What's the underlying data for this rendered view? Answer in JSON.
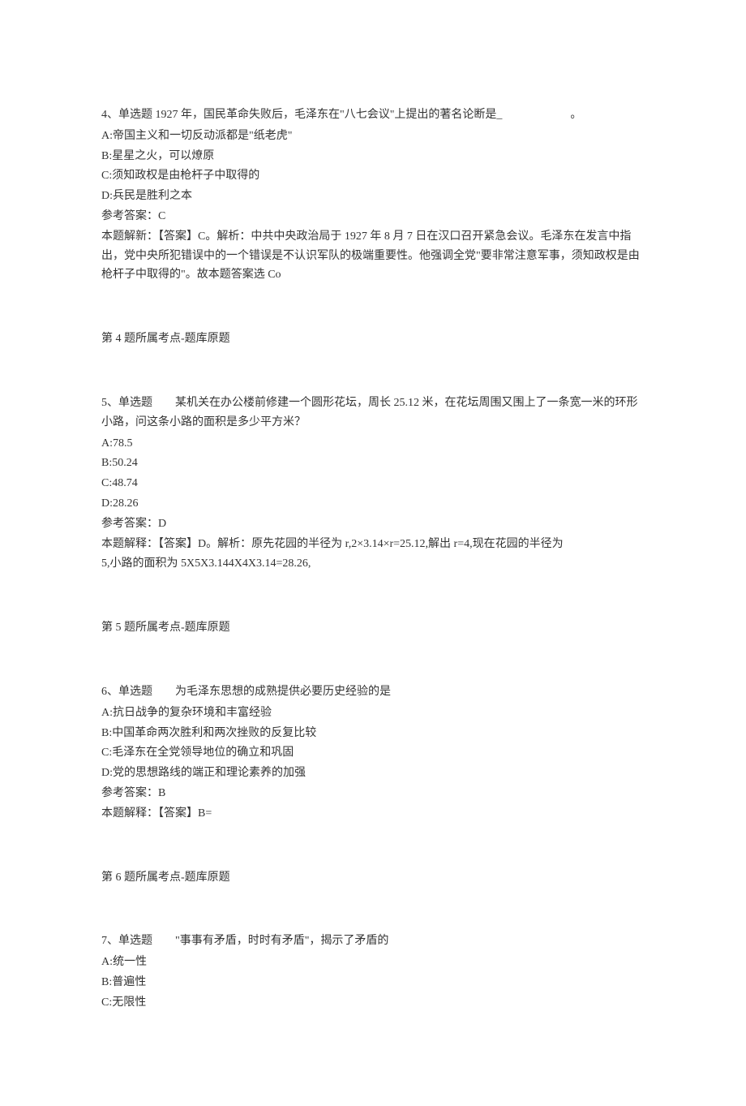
{
  "q4": {
    "stem": "4、单选题 1927 年，国民革命失败后，毛泽东在\"八七会议\"上提出的著名论断是_　　　　　　。",
    "optA": "A:帝国主义和一切反动派都是\"纸老虎\"",
    "optB": "B:星星之火，可以燎原",
    "optC": "C:须知政权是由枪杆子中取得的",
    "optD": "D:兵民是胜利之本",
    "ans": "参考答案：C",
    "expl": "本题解新：【答案】C。解析：中共中央政治局于 1927 年 8 月 7 日在汉口召开紧急会议。毛泽东在发言中指出，党中央所犯错误中的一个错误是不认识军队的极端重要性。他强调全党\"要非常注意军事，须知政权是由枪杆子中取得的\"。故本题答案选 Co",
    "topic": "第 4 题所属考点-题库原题"
  },
  "q5": {
    "stem": "5、单选题　　某机关在办公楼前修建一个圆形花坛，周长 25.12 米，在花坛周围又围上了一条宽一米的环形小路，问这条小路的面积是多少平方米？",
    "optA": "A:78.5",
    "optB": "B:50.24",
    "optC": "C:48.74",
    "optD": "D:28.26",
    "ans": "参考答案：D",
    "expl1": "本题解释：【答案】D。解析：原先花园的半径为 r,2×3.14×r=25.12,解出 r=4,现在花园的半径为",
    "expl2": "5,小路的面积为 5X5X3.144X4X3.14=28.26,",
    "topic": "第 5 题所属考点-题库原题"
  },
  "q6": {
    "stem": "6、单选题　　为毛泽东思想的成熟提供必要历史经验的是",
    "optA": "A:抗日战争的复杂环境和丰富经验",
    "optB": "B:中国革命两次胜利和两次挫败的反复比较",
    "optC": "C:毛泽东在全党领导地位的确立和巩固",
    "optD": "D:党的思想路线的端正和理论素养的加强",
    "ans": "参考答案：B",
    "expl": "本题解释：【答案】B=",
    "topic": "第 6 题所属考点-题库原题"
  },
  "q7": {
    "stem": "7、单选题　　\"事事有矛盾，时时有矛盾\"，揭示了矛盾的",
    "optA": "A:统一性",
    "optB": "B:普遍性",
    "optC": "C:无限性"
  }
}
